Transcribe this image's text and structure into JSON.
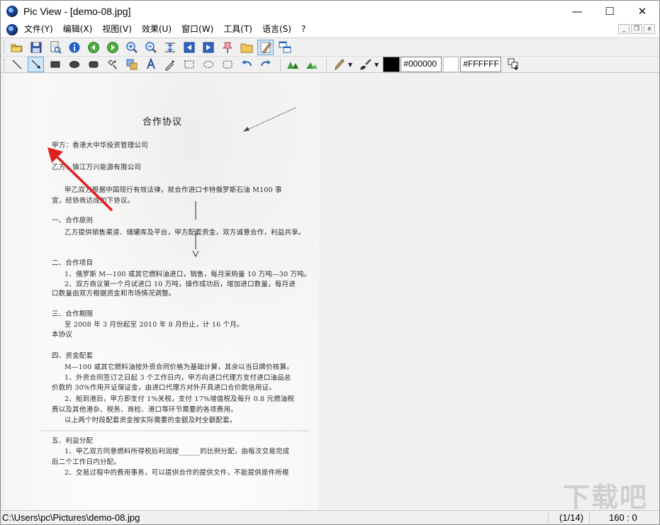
{
  "window": {
    "title": "Pic View - [demo-08.jpg]",
    "controls": {
      "minimize": "—",
      "maximize": "☐",
      "close": "✕"
    }
  },
  "menu": {
    "items": [
      "文件(Y)",
      "编辑(X)",
      "视图(V)",
      "效果(U)",
      "窗口(W)",
      "工具(T)",
      "语言(S)",
      "?"
    ],
    "mdi": {
      "minimize": "_",
      "restore": "❐",
      "close": "x"
    }
  },
  "toolbar1": {
    "icons": [
      "open-folder",
      "save",
      "print-preview",
      "info",
      "previous",
      "next",
      "zoom-in",
      "zoom-out",
      "fit",
      "prev-image",
      "next-image",
      "pin",
      "browse-folder",
      "draw-mode",
      "windows"
    ]
  },
  "toolbar2": {
    "icons": [
      "line",
      "arrow",
      "filled-rectangle",
      "filled-ellipse",
      "rounded-rectangle",
      "eyedropper-link",
      "clone",
      "text",
      "picker",
      "select-rectangle",
      "select-ellipse",
      "select-rounded",
      "undo",
      "redo",
      "sharpen",
      "blur",
      "pen",
      "brush"
    ],
    "foreground_color": "#000000",
    "background_color": "#FFFFFF"
  },
  "document": {
    "title": "合作协议",
    "lines": [
      "甲方：香港大中华投资管理公司",
      "乙方：镇江万兴能源有限公司",
      "甲乙双方根据中国现行有效法律，就合作进口卡特俄罗斯石油 M100 事",
      "宜，经协商达成如下协议。",
      "一、合作原则",
      "乙方提供销售渠道、储罐库及平台，甲方配套资金，双方诚意合作，利益共享。",
      "二、合作项目",
      "1、俄罗斯 M—100 或其它燃料油进口，销售，每月采购量 10 万吨—30 万吨。",
      "2、双方商议第一个月试进口 10 万吨，操作成功后，增加进口数量，每月进",
      "口数量由双方根据资金和市场情况调整。",
      "三、合作期限",
      "至 2008 年 3 月份起至 2010 年 8 月份止，计 16 个月。",
      "本协议",
      "四、资金配套",
      "M—100 或其它燃料油按外资合同价格为基础计算，其余以当日牌价核算。",
      "1、外资合同签订之日起 3 个工作日内，甲方向进口代理方支付进口油品总",
      "价款的 30%作用开证保证金，由进口代理方对外开具进口合价款信用证。",
      "2、船到港后，甲方即支付 1%关税，支付 17%增值税及每升 0.8 元燃油税",
      "费以及其他港杂、税务、商检、港口等环节需要的各项费用。",
      "以上两个时段配套资金按实际需要的金额及时全额配套。",
      "五、利益分配",
      "1、甲乙双方同意燃料所得税后利润按______的比例分配，由每次交易完成",
      "后二个工作日内分配。",
      "2、交易过程中的费用事务，可以提供合作的提供文件，不能提供原件所根"
    ]
  },
  "watermark": "下载吧",
  "status": {
    "path": "C:\\Users\\pc\\Pictures\\demo-08.jpg",
    "page": "(1/14)",
    "position": "160 : 0"
  }
}
